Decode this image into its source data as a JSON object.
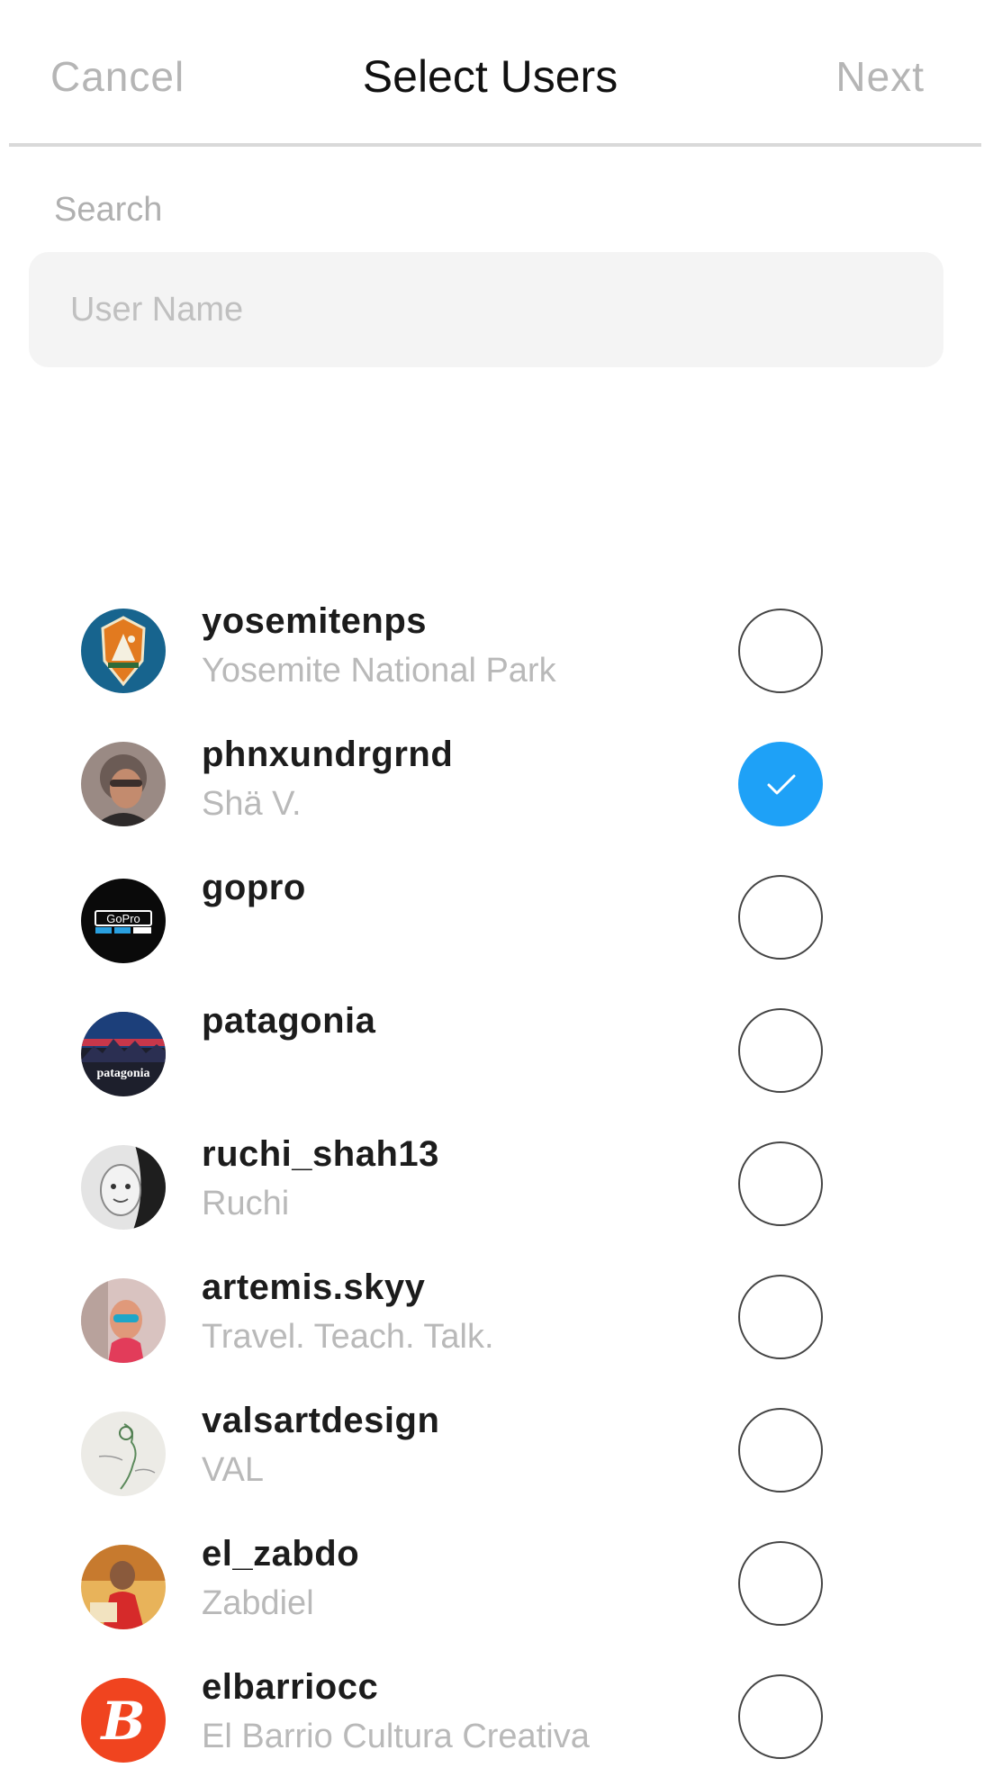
{
  "header": {
    "cancel_label": "Cancel",
    "title": "Select Users",
    "next_label": "Next"
  },
  "search": {
    "label": "Search",
    "placeholder": "User Name",
    "value": ""
  },
  "colors": {
    "accent": "#1ea1f7",
    "muted_text": "#b5b5b5"
  },
  "users": [
    {
      "username": "yosemitenps",
      "fullname": "Yosemite National Park",
      "selected": false,
      "avatar_icon": "nps-arrowhead-logo-icon"
    },
    {
      "username": "phnxundrgrnd",
      "fullname": "Shä V.",
      "selected": true,
      "avatar_icon": "person-photo-icon"
    },
    {
      "username": "gopro",
      "fullname": "",
      "selected": false,
      "avatar_icon": "gopro-logo-icon"
    },
    {
      "username": "patagonia",
      "fullname": "",
      "selected": false,
      "avatar_icon": "patagonia-logo-icon"
    },
    {
      "username": "ruchi_shah13",
      "fullname": "Ruchi",
      "selected": false,
      "avatar_icon": "person-photo-icon"
    },
    {
      "username": "artemis.skyy",
      "fullname": "Travel. Teach. Talk.",
      "selected": false,
      "avatar_icon": "person-photo-icon"
    },
    {
      "username": "valsartdesign",
      "fullname": "VAL",
      "selected": false,
      "avatar_icon": "sketch-photo-icon"
    },
    {
      "username": "el_zabdo",
      "fullname": "Zabdiel",
      "selected": false,
      "avatar_icon": "person-photo-icon"
    },
    {
      "username": "elbarriocc",
      "fullname": "El Barrio Cultura Creativa",
      "selected": false,
      "avatar_icon": "elbarrio-b-logo-icon"
    }
  ]
}
